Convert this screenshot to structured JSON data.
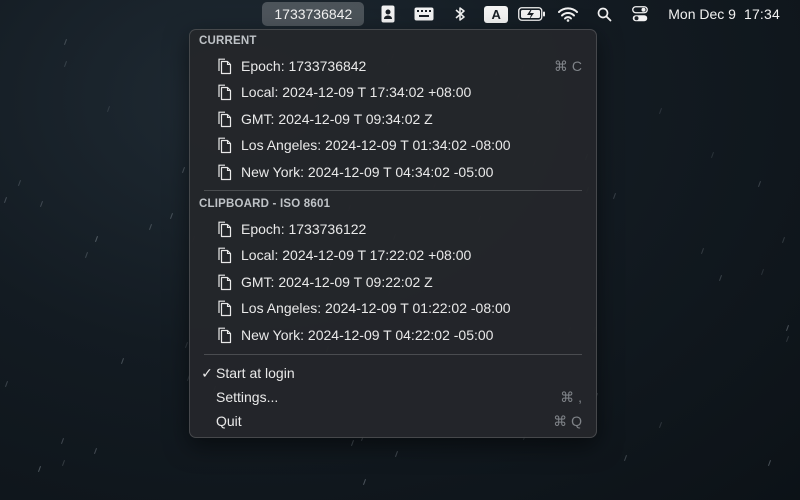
{
  "menubar": {
    "active_item": "1733736842",
    "icons": [
      "contact-card-icon",
      "keyboard-icon",
      "bluetooth-icon",
      "input-source-a-icon",
      "battery-charging-icon",
      "wifi-icon",
      "search-icon",
      "control-center-icon"
    ],
    "input_source_letter": "A",
    "date": "Mon Dec 9",
    "time": "17:34"
  },
  "menu": {
    "current": {
      "title": "CURRENT",
      "items": [
        {
          "label": "Epoch: 1733736842",
          "shortcut": "⌘ C"
        },
        {
          "label": "Local: 2024-12-09 T 17:34:02 +08:00",
          "shortcut": ""
        },
        {
          "label": "GMT: 2024-12-09 T 09:34:02 Z",
          "shortcut": ""
        },
        {
          "label": "Los Angeles: 2024-12-09 T 01:34:02 -08:00",
          "shortcut": ""
        },
        {
          "label": "New York: 2024-12-09 T 04:34:02 -05:00",
          "shortcut": ""
        }
      ]
    },
    "clipboard": {
      "title": "CLIPBOARD - ISO 8601",
      "items": [
        {
          "label": "Epoch: 1733736122"
        },
        {
          "label": "Local: 2024-12-09 T 17:22:02 +08:00"
        },
        {
          "label": "GMT: 2024-12-09 T 09:22:02 Z"
        },
        {
          "label": "Los Angeles: 2024-12-09 T 01:22:02 -08:00"
        },
        {
          "label": "New York: 2024-12-09 T 04:22:02 -05:00"
        }
      ]
    },
    "actions": [
      {
        "label": "Start at login",
        "checked": "✓",
        "shortcut": ""
      },
      {
        "label": "Settings...",
        "checked": "",
        "shortcut": "⌘ ,"
      },
      {
        "label": "Quit",
        "checked": "",
        "shortcut": "⌘ Q"
      }
    ]
  }
}
